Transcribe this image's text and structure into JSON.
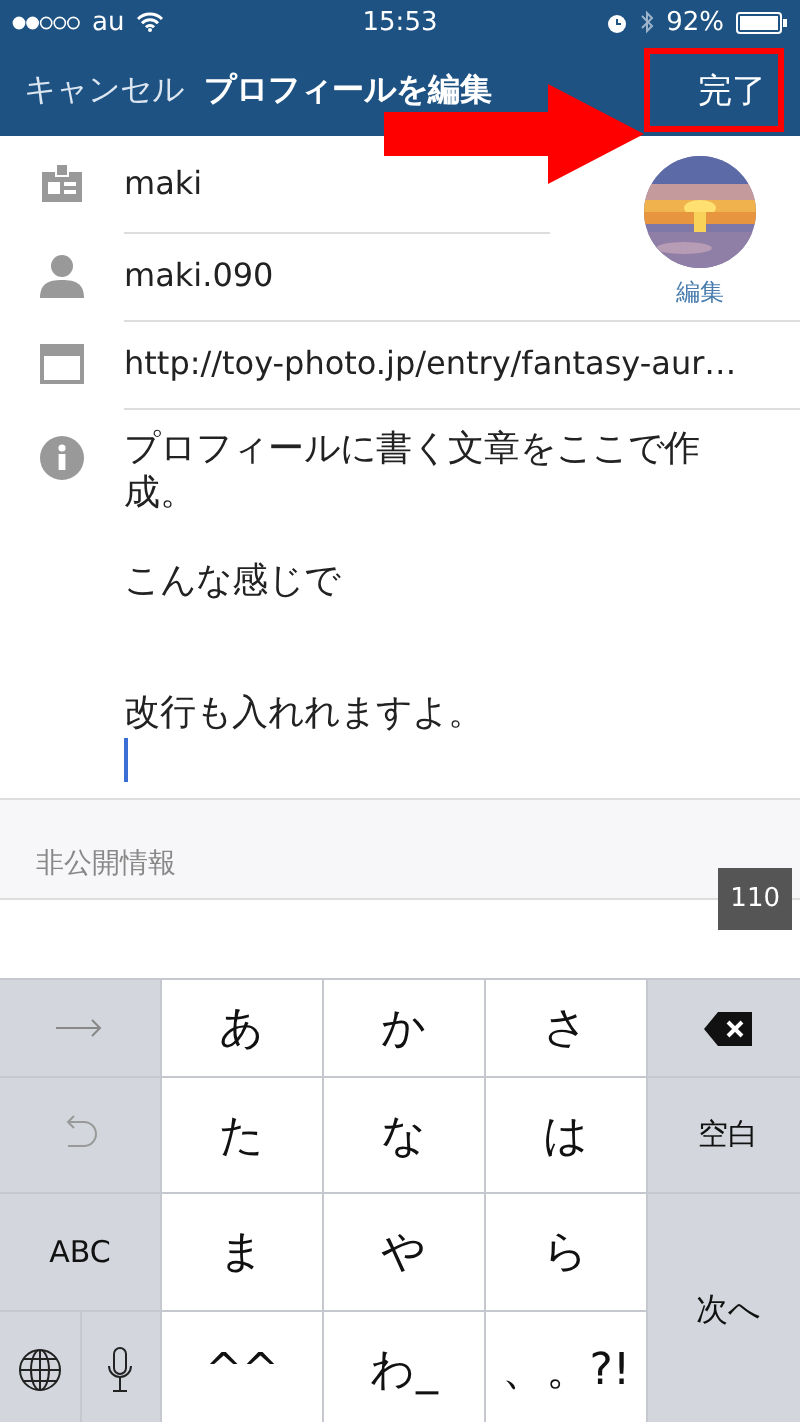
{
  "status_bar": {
    "carrier": "au",
    "time": "15:53",
    "battery": "92%"
  },
  "nav": {
    "cancel": "キャンセル",
    "title": "プロフィールを編集",
    "done": "完了"
  },
  "annotation": {
    "highlight_done": true,
    "arrow": true
  },
  "avatar": {
    "kind": "picture",
    "edit": "編集"
  },
  "fields": [
    {
      "kind": "name",
      "value": "maki"
    },
    {
      "kind": "user",
      "value": "maki.090"
    },
    {
      "kind": "web",
      "value": "http://toy-photo.jp/entry/fantasy-aur…"
    }
  ],
  "bio": {
    "lines": [
      "プロフィールに書く文章をここで作成。",
      "こんな感じで",
      "改行も入れれますよ。"
    ],
    "cursor": true
  },
  "section_header": "非公開情報",
  "counter": "110",
  "keyboard": [
    {
      "kind": "arrow"
    },
    {
      "kind": "char",
      "label": "あ"
    },
    {
      "kind": "char",
      "label": "か"
    },
    {
      "kind": "char",
      "label": "さ"
    },
    {
      "kind": "delete"
    },
    {
      "kind": "undo"
    },
    {
      "kind": "char",
      "label": "た"
    },
    {
      "kind": "char",
      "label": "な"
    },
    {
      "kind": "char",
      "label": "は"
    },
    {
      "kind": "func",
      "label": "空白"
    },
    {
      "kind": "func",
      "label": "ABC"
    },
    {
      "kind": "char",
      "label": "ま"
    },
    {
      "kind": "char",
      "label": "や"
    },
    {
      "kind": "char",
      "label": "ら"
    },
    {
      "kind": "enter",
      "label": "次へ"
    },
    {
      "kind": "globe"
    },
    {
      "kind": "mic"
    },
    {
      "kind": "char",
      "label": "^^"
    },
    {
      "kind": "char",
      "label": "わ_"
    },
    {
      "kind": "char",
      "label": "、。?!"
    }
  ]
}
